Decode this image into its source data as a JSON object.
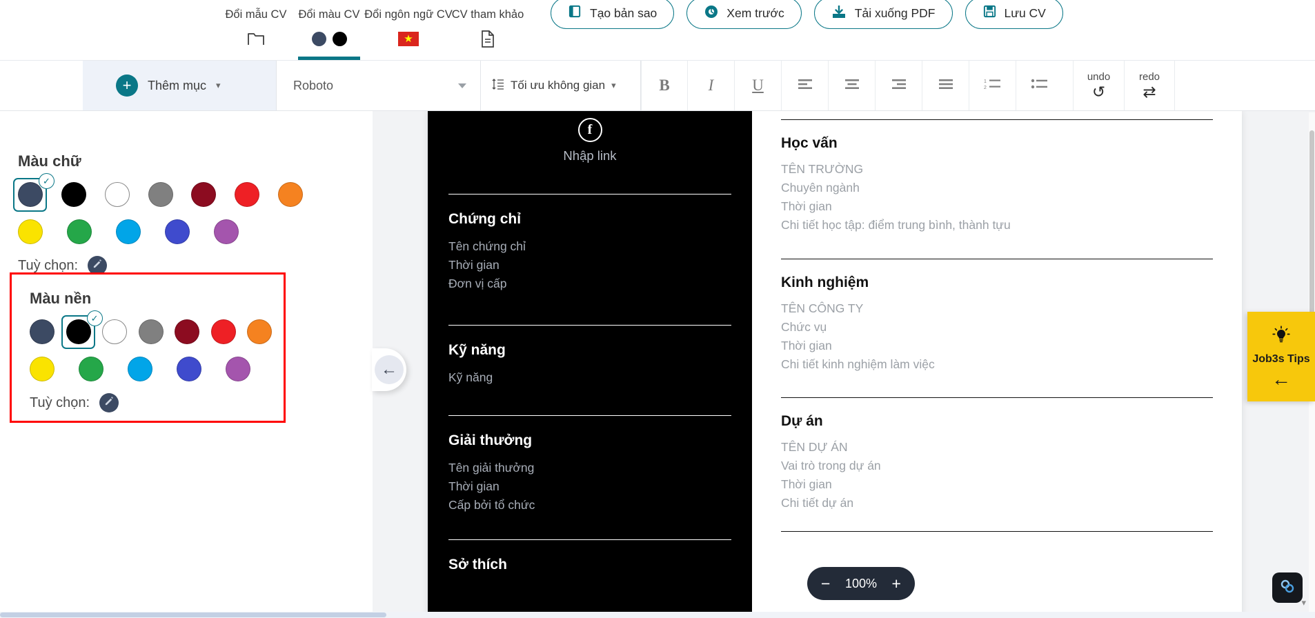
{
  "topbar": {
    "menu": [
      {
        "label": "Đổi mẫu CV",
        "icon": "folder-icon",
        "active": false
      },
      {
        "label": "Đổi màu CV",
        "icon": "color-dots-icon",
        "active": true
      },
      {
        "label": "Đổi ngôn ngữ CV",
        "icon": "vietnam-flag-icon",
        "active": false
      },
      {
        "label": "CV tham khảo",
        "icon": "document-icon",
        "active": false
      }
    ],
    "actions": [
      {
        "label": "Tạo bản sao",
        "icon": "copy-icon"
      },
      {
        "label": "Xem trước",
        "icon": "eye-icon"
      },
      {
        "label": "Tải xuống PDF",
        "icon": "download-icon"
      },
      {
        "label": "Lưu CV",
        "icon": "save-icon"
      }
    ]
  },
  "toolbar": {
    "add_section_label": "Thêm mục",
    "font_value": "Roboto",
    "spacing_label": "Tối ưu không gian",
    "bold": "B",
    "italic": "I",
    "underline": "U",
    "undo_label": "undo",
    "redo_label": "redo"
  },
  "left_panel": {
    "text_color": {
      "title": "Màu chữ",
      "custom_label": "Tuỳ chọn:",
      "selected_index": 0,
      "swatches": [
        "#3c4a63",
        "#000000",
        "#ffffff",
        "#808080",
        "#8c0c20",
        "#ee2025",
        "#f58220",
        "#fae300",
        "#25a749",
        "#01a5e8",
        "#3f4bcd",
        "#a455ad"
      ]
    },
    "background_color": {
      "title": "Màu nền",
      "custom_label": "Tuỳ chọn:",
      "selected_index": 1,
      "highlighted": true,
      "highlight_color": "#ff0000",
      "swatches": [
        "#3c4a63",
        "#000000",
        "#ffffff",
        "#808080",
        "#8c0c20",
        "#ee2025",
        "#f58220",
        "#fae300",
        "#25a749",
        "#01a5e8",
        "#3f4bcd",
        "#a455ad"
      ]
    }
  },
  "cv": {
    "left_column": {
      "contact_link_label": "Nhập link",
      "sections": [
        {
          "heading": "Chứng chỉ",
          "lines": [
            "Tên chứng chỉ",
            "Thời gian",
            "Đơn vị cấp"
          ]
        },
        {
          "heading": "Kỹ năng",
          "lines": [
            "Kỹ năng"
          ]
        },
        {
          "heading": "Giải thưởng",
          "lines": [
            "Tên giải thưởng",
            "Thời gian",
            "Cấp bởi tổ chức"
          ]
        },
        {
          "heading": "Sở thích",
          "lines": []
        }
      ]
    },
    "right_column": {
      "sections": [
        {
          "heading": "Học vấn",
          "lines": [
            "TÊN TRƯỜNG",
            "Chuyên ngành",
            "Thời gian",
            "Chi tiết học tập: điểm trung bình, thành tựu"
          ]
        },
        {
          "heading": "Kinh nghiệm",
          "lines": [
            "TÊN CÔNG TY",
            "Chức vụ",
            "Thời gian",
            "Chi tiết kinh nghiệm làm việc"
          ]
        },
        {
          "heading": "Dự án",
          "lines": [
            "TÊN DỰ ÁN",
            "Vai trò trong dự án",
            "Thời gian",
            "Chi tiết dự án"
          ]
        }
      ]
    }
  },
  "zoom_control": {
    "minus": "−",
    "percent": "100%",
    "plus": "+"
  },
  "tips_widget": {
    "label": "Job3s Tips",
    "arrow": "←",
    "bg_color": "#f7c80c"
  },
  "collapse_handle": {
    "arrow": "←"
  },
  "chat_button": {
    "icon": "chat-link-icon"
  }
}
